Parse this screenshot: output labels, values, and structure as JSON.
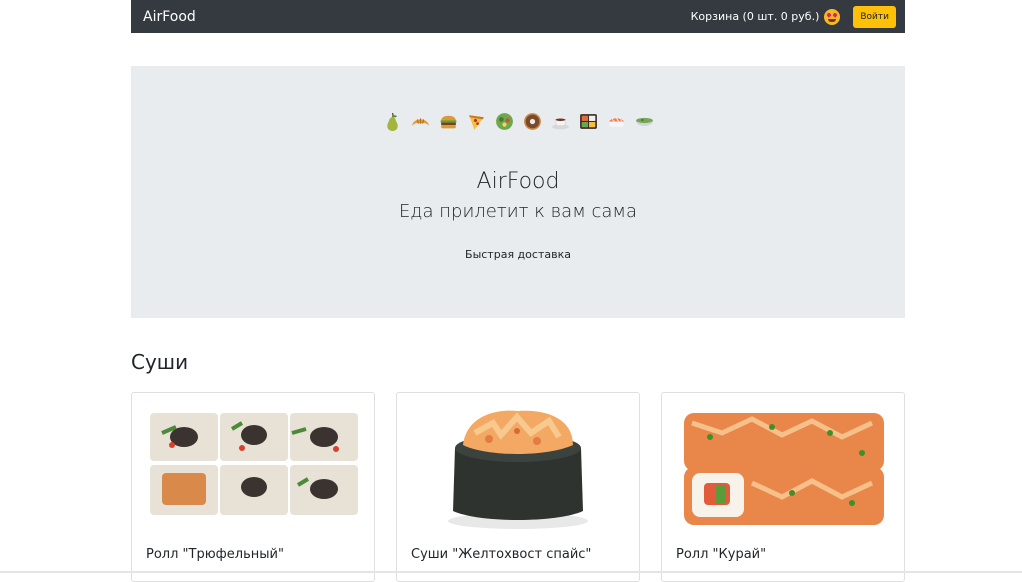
{
  "navbar": {
    "brand": "AirFood",
    "cart_label": "Корзина (0 шт. 0 руб.)",
    "cart_emoji_icon": "heart-eyes-face-icon",
    "login_label": "Войти",
    "login_color": "#ffc107",
    "background": "#343a40"
  },
  "hero": {
    "icons": [
      "pear-icon",
      "croissant-icon",
      "burger-icon",
      "pizza-icon",
      "salad-icon",
      "donut-icon",
      "coffee-icon",
      "bento-icon",
      "sushi-icon",
      "soup-icon"
    ],
    "title": "AirFood",
    "subtitle": "Еда прилетит к вам сама",
    "note": "Быстрая доставка"
  },
  "section": {
    "title": "Суши"
  },
  "products": [
    {
      "name": "Ролл \"Трюфельный\"",
      "image_icon": "truffle-roll-image"
    },
    {
      "name": "Суши \"Желтохвост спайс\"",
      "image_icon": "yellowtail-sushi-image"
    },
    {
      "name": "Ролл \"Курай\"",
      "image_icon": "kurai-roll-image"
    }
  ]
}
